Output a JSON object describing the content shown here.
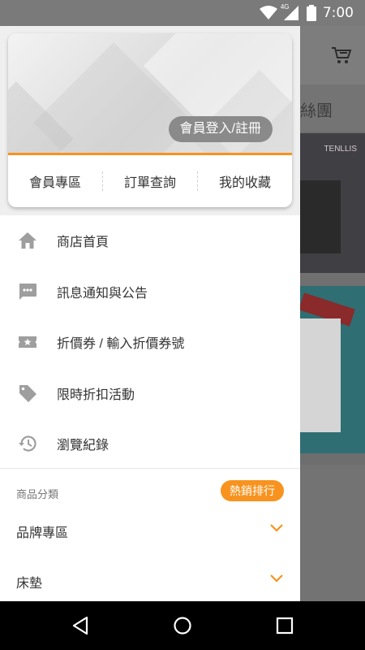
{
  "status_bar": {
    "time": "7:00",
    "network": "4G",
    "icons": [
      "wifi-icon",
      "signal-icon",
      "battery-icon"
    ]
  },
  "drawer": {
    "member": {
      "login_label": "會員登入/註冊",
      "tabs": [
        {
          "label": "會員專區"
        },
        {
          "label": "訂單查詢"
        },
        {
          "label": "我的收藏"
        }
      ]
    },
    "menu": [
      {
        "icon": "home-icon",
        "label": "商店首頁"
      },
      {
        "icon": "message-icon",
        "label": "訊息通知與公告"
      },
      {
        "icon": "coupon-icon",
        "label": "折價券 / 輸入折價券號"
      },
      {
        "icon": "tag-icon",
        "label": "限時折扣活動"
      },
      {
        "icon": "history-icon",
        "label": "瀏覽紀錄"
      }
    ],
    "categories": {
      "title": "商品分類",
      "hot_label": "熱銷排行",
      "items": [
        {
          "label": "品牌專區"
        },
        {
          "label": "床墊"
        }
      ]
    }
  },
  "background_app": {
    "strip_text": "絲團",
    "banner_brand": "TENLLIS"
  },
  "colors": {
    "accent": "#f7931e",
    "icon_gray": "#9e9e9e"
  },
  "nav_bar": {
    "buttons": [
      "back-icon",
      "home-circle-icon",
      "recents-icon"
    ]
  }
}
